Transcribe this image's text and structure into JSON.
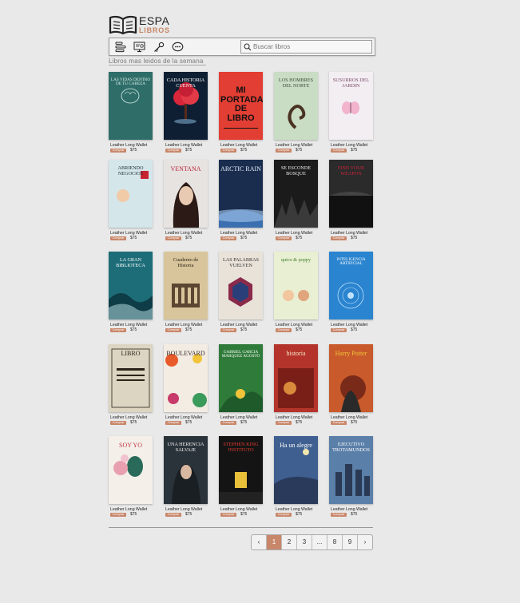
{
  "logo": {
    "line1": "ESPA",
    "line2": "LIBROS"
  },
  "toolbar": {
    "icons": [
      "list-icon",
      "monitor-icon",
      "key-icon",
      "chat-icon"
    ],
    "search_placeholder": "Buscar libros"
  },
  "section": {
    "title": "Libros mas leidos de la semana"
  },
  "books": [
    {
      "name": "Leather Long Wallet",
      "btn": "Comprar",
      "price": "$75",
      "cover_title": "LAS VIDAS DENTRO DE TU CABEZA",
      "bg": "#2f6d69",
      "fg": "#d9efe8",
      "motif": "brain"
    },
    {
      "name": "Leather Long Wallet",
      "btn": "Comprar",
      "price": "$75",
      "cover_title": "CADA HISTORIA CUENTA",
      "bg": "#0f1f33",
      "fg": "#ffffff",
      "motif": "tree"
    },
    {
      "name": "Leather Long Wallet",
      "btn": "Comprar",
      "price": "$75",
      "cover_title": "MI PORTADA DE LIBRO",
      "bg": "#e23e33",
      "fg": "#111111",
      "motif": "block"
    },
    {
      "name": "Leather Long Wallet",
      "btn": "Comprar",
      "price": "$75",
      "cover_title": "LOS HOMBRES DEL NORTE",
      "bg": "#c9dcc4",
      "fg": "#3e4b3a",
      "motif": "scroll"
    },
    {
      "name": "Leather Long Wallet",
      "btn": "Comprar",
      "price": "$75",
      "cover_title": "SUSURROS DEL JARDIN",
      "bg": "#f3eef2",
      "fg": "#7a4868",
      "motif": "butterfly"
    },
    {
      "name": "Leather Long Wallet",
      "btn": "Comprar",
      "price": "$75",
      "cover_title": "ABRIENDO NEGOCIOS",
      "bg": "#d4e6ea",
      "fg": "#23303a",
      "motif": "face"
    },
    {
      "name": "Leather Long Wallet",
      "btn": "Comprar",
      "price": "$75",
      "cover_title": "VENTANA",
      "bg": "#e7e3e1",
      "fg": "#b8233a",
      "motif": "woman"
    },
    {
      "name": "Leather Long Wallet",
      "btn": "Comprar",
      "price": "$75",
      "cover_title": "ARCTIC RAIN",
      "bg": "#1a2d4e",
      "fg": "#e4eefc",
      "motif": "earth"
    },
    {
      "name": "Leather Long Wallet",
      "btn": "Comprar",
      "price": "$75",
      "cover_title": "SE ESCONDE BOSQUE",
      "bg": "#1b1b1b",
      "fg": "#eeeeee",
      "motif": "forest"
    },
    {
      "name": "Leather Long Wallet",
      "btn": "Comprar",
      "price": "$75",
      "cover_title": "FIND YOUR WEAPON",
      "bg": "#2b2b2b",
      "fg": "#c9263b",
      "motif": "dark"
    },
    {
      "name": "Leather Long Wallet",
      "btn": "Comprar",
      "price": "$75",
      "cover_title": "LA GRAN BIBLIOTECA",
      "bg": "#1d6d78",
      "fg": "#ffffff",
      "motif": "wave"
    },
    {
      "name": "Leather Long Wallet",
      "btn": "Comprar",
      "price": "$75",
      "cover_title": "Cuaderno de Historia",
      "bg": "#d9c59b",
      "fg": "#2a2218",
      "motif": "building"
    },
    {
      "name": "Leather Long Wallet",
      "btn": "Comprar",
      "price": "$75",
      "cover_title": "LAS PALABRAS VUELVEN",
      "bg": "#e8e2d8",
      "fg": "#333333",
      "motif": "hex"
    },
    {
      "name": "Leather Long Wallet",
      "btn": "Comprar",
      "price": "$75",
      "cover_title": "quico & poppy",
      "bg": "#e9efd2",
      "fg": "#3d7c2a",
      "motif": "kids"
    },
    {
      "name": "Leather Long Wallet",
      "btn": "Comprar",
      "price": "$75",
      "cover_title": "INTELIGENCIA ARTIFICIAL",
      "bg": "#2a84cf",
      "fg": "#ffffff",
      "motif": "circuit"
    },
    {
      "name": "Leather Long Wallet",
      "btn": "Comprar",
      "price": "$75",
      "cover_title": "LIBRO",
      "bg": "#dcd5c1",
      "fg": "#2a2419",
      "motif": "vintage"
    },
    {
      "name": "Leather Long Wallet",
      "btn": "Comprar",
      "price": "$75",
      "cover_title": "BOULEVARD",
      "bg": "#f2ece3",
      "fg": "#3a2a2a",
      "motif": "floral"
    },
    {
      "name": "Leather Long Wallet",
      "btn": "Comprar",
      "price": "$75",
      "cover_title": "GABRIEL GARCIA MARQUEZ AGOSTO",
      "bg": "#2f7b3a",
      "fg": "#ffffff",
      "motif": "jungle"
    },
    {
      "name": "Leather Long Wallet",
      "btn": "Comprar",
      "price": "$75",
      "cover_title": "historia",
      "bg": "#b4342b",
      "fg": "#f5e6c8",
      "motif": "paint"
    },
    {
      "name": "Leather Long Wallet",
      "btn": "Comprar",
      "price": "$75",
      "cover_title": "Harry Potter",
      "bg": "#c85a2b",
      "fg": "#f3c43a",
      "motif": "hp"
    },
    {
      "name": "Leather Long Wallet",
      "btn": "Comprar",
      "price": "$75",
      "cover_title": "SOY YO",
      "bg": "#f4efe9",
      "fg": "#c43a48",
      "motif": "portrait"
    },
    {
      "name": "Leather Long Wallet",
      "btn": "Comprar",
      "price": "$75",
      "cover_title": "UNA HERENCIA SALVAJE",
      "bg": "#2a333a",
      "fg": "#f0f0f0",
      "motif": "girl"
    },
    {
      "name": "Leather Long Wallet",
      "btn": "Comprar",
      "price": "$75",
      "cover_title": "STEPHEN KING INSTITUTO",
      "bg": "#141414",
      "fg": "#e53b2f",
      "motif": "king"
    },
    {
      "name": "Leather Long Wallet",
      "btn": "Comprar",
      "price": "$75",
      "cover_title": "Ha un alegre",
      "bg": "#3e5f8f",
      "fg": "#ffffff",
      "motif": "night"
    },
    {
      "name": "Leather Long Wallet",
      "btn": "Comprar",
      "price": "$75",
      "cover_title": "EJECUTIVO TROTAMUNDOS",
      "bg": "#5a7fa8",
      "fg": "#ffffff",
      "motif": "city"
    }
  ],
  "pagination": {
    "prev": "‹",
    "pages": [
      "1",
      "2",
      "3",
      "...",
      "8",
      "9"
    ],
    "active": "1",
    "next": "›"
  }
}
